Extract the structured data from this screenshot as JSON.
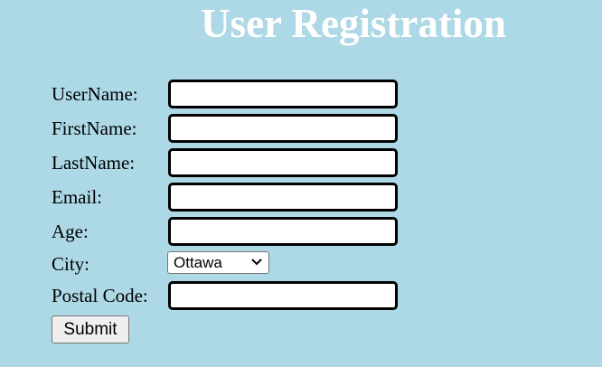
{
  "page": {
    "title": "User Registration"
  },
  "form": {
    "fields": [
      {
        "label": "UserName:",
        "value": ""
      },
      {
        "label": "FirstName:",
        "value": ""
      },
      {
        "label": "LastName:",
        "value": ""
      },
      {
        "label": "Email:",
        "value": ""
      },
      {
        "label": "Age:",
        "value": ""
      },
      {
        "label": "City:",
        "selected": "Ottawa"
      },
      {
        "label": "Postal Code:",
        "value": ""
      }
    ],
    "submit_label": "Submit"
  }
}
